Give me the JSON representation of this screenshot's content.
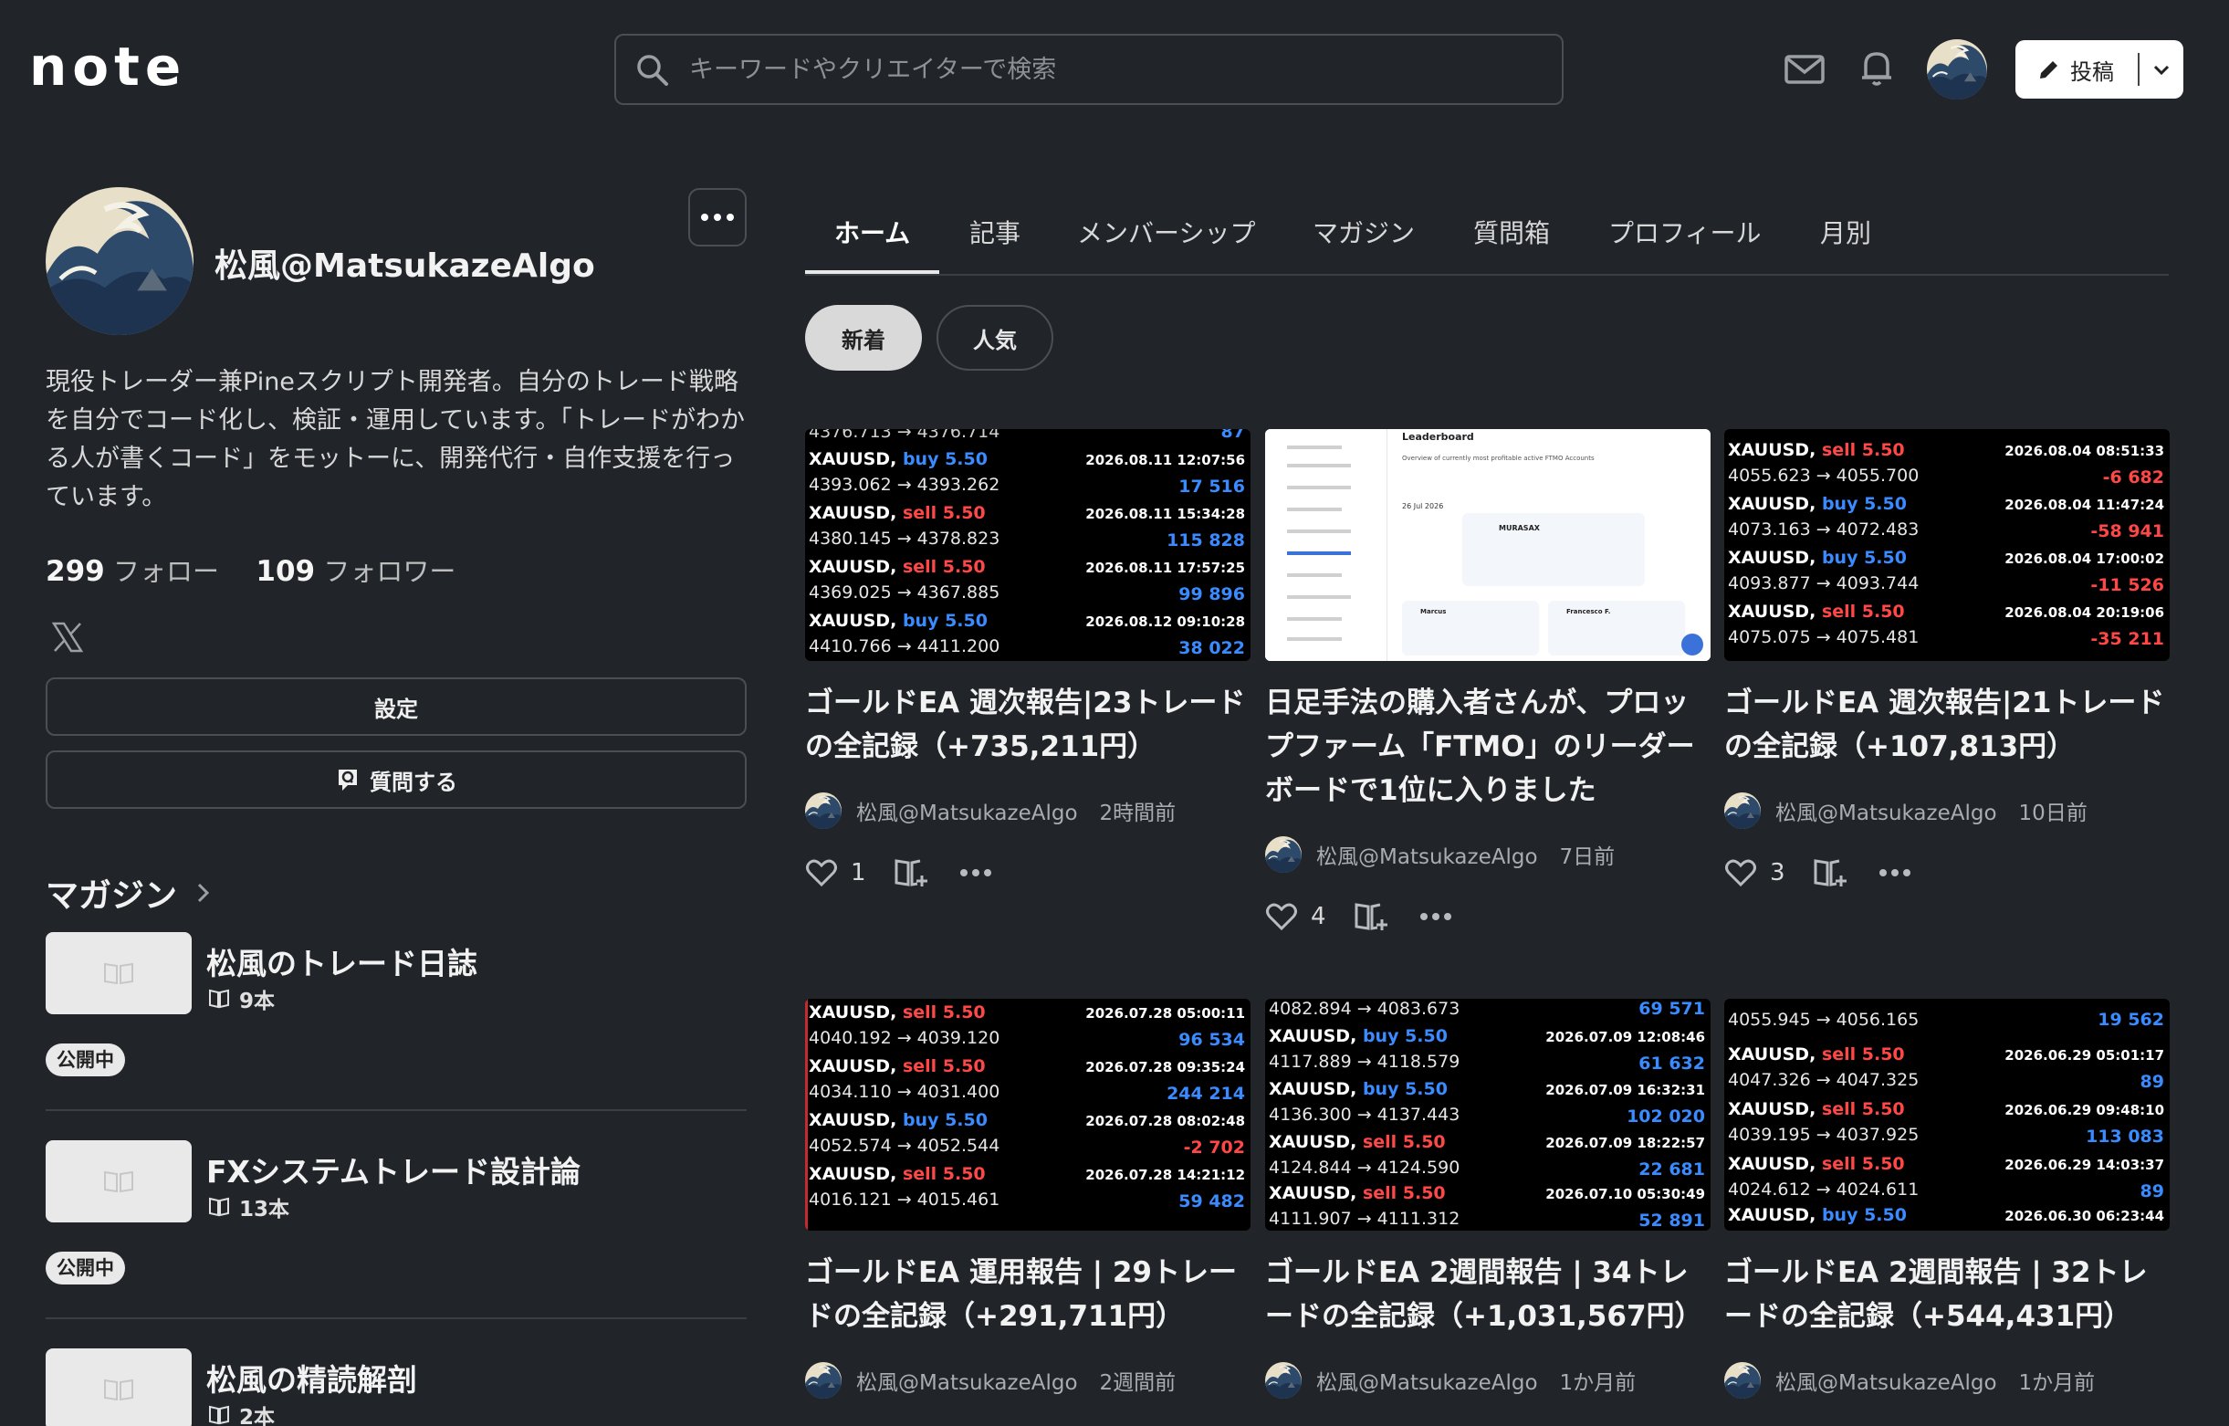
{
  "header": {
    "logo": "note",
    "search_placeholder": "キーワードやクリエイターで検索",
    "post_label": "投稿"
  },
  "profile": {
    "name": "松風@MatsukazeAlgo",
    "bio": "現役トレーダー兼Pineスクリプト開発者。自分のトレード戦略を自分でコード化し、検証・運用しています。「トレードがわかる人が書くコード」をモットーに、開発代行・自作支援を行っています。",
    "follow_count": "299",
    "follow_label": "フォロー",
    "follower_count": "109",
    "follower_label": "フォロワー",
    "settings_label": "設定",
    "ask_label": "質問する"
  },
  "magazines": {
    "heading": "マガジン",
    "items": [
      {
        "title": "松風のトレード日誌",
        "count": "9本",
        "badge": "公開中"
      },
      {
        "title": "FXシステムトレード設計論",
        "count": "13本",
        "badge": "公開中"
      },
      {
        "title": "松風の精読解剖",
        "count": "2本",
        "badge": ""
      }
    ]
  },
  "tabs": [
    "ホーム",
    "記事",
    "メンバーシップ",
    "マガジン",
    "質問箱",
    "プロフィール",
    "月別"
  ],
  "filters": {
    "new": "新着",
    "popular": "人気"
  },
  "articles": [
    {
      "title": "ゴールドEA 週次報告|23トレードの全記録（+735,211円）",
      "author": "松風@MatsukazeAlgo",
      "time": "2時間前",
      "likes": "1",
      "top_partial": "4376.713 → 4376.714",
      "top_partial_pnl": "87",
      "trades": [
        {
          "sym": "XAUUSD,",
          "side": "buy 5.50",
          "dir": "buy",
          "dt": "2026.08.11 12:07:56",
          "px": "4393.062 → 4393.262",
          "pnl": "17 516"
        },
        {
          "sym": "XAUUSD,",
          "side": "sell 5.50",
          "dir": "sell",
          "dt": "2026.08.11 15:34:28",
          "px": "4380.145 → 4378.823",
          "pnl": "115 828"
        },
        {
          "sym": "XAUUSD,",
          "side": "sell 5.50",
          "dir": "sell",
          "dt": "2026.08.11 17:57:25",
          "px": "4369.025 → 4367.885",
          "pnl": "99 896"
        },
        {
          "sym": "XAUUSD,",
          "side": "buy 5.50",
          "dir": "buy",
          "dt": "2026.08.12 09:10:28",
          "px": "4410.766 → 4411.200",
          "pnl": "38 022"
        }
      ]
    },
    {
      "title": "日足手法の購入者さんが、プロップファーム「FTMO」のリーダーボードで1位に入りました",
      "author": "松風@MatsukazeAlgo",
      "time": "7日前",
      "likes": "4",
      "leaderboard": {
        "heading": "Leaderboard",
        "sub": "Overview of currently most profitable active FTMO Accounts",
        "date": "26 Jul 2026",
        "name1": "MURASAX",
        "name2": "Marcus",
        "name3": "Francesco F."
      }
    },
    {
      "title": "ゴールドEA 週次報告|21トレードの全記録（+107,813円）",
      "author": "松風@MatsukazeAlgo",
      "time": "10日前",
      "likes": "3",
      "trades": [
        {
          "sym": "XAUUSD,",
          "side": "sell 5.50",
          "dir": "sell",
          "dt": "2026.08.04 08:51:33",
          "px": "4055.623 → 4055.700",
          "pnl": "-6 682"
        },
        {
          "sym": "XAUUSD,",
          "side": "buy 5.50",
          "dir": "buy",
          "dt": "2026.08.04 11:47:24",
          "px": "4073.163 → 4072.483",
          "pnl": "-58 941"
        },
        {
          "sym": "XAUUSD,",
          "side": "buy 5.50",
          "dir": "buy",
          "dt": "2026.08.04 17:00:02",
          "px": "4093.877 → 4093.744",
          "pnl": "-11 526"
        },
        {
          "sym": "XAUUSD,",
          "side": "sell 5.50",
          "dir": "sell",
          "dt": "2026.08.04 20:19:06",
          "px": "4075.075 → 4075.481",
          "pnl": "-35 211"
        }
      ]
    },
    {
      "title": "ゴールドEA 運用報告 | 29トレードの全記録（+291,711円）",
      "author": "松風@MatsukazeAlgo",
      "time": "2週間前",
      "trades": [
        {
          "sym": "XAUUSD,",
          "side": "sell 5.50",
          "dir": "sell",
          "dt": "2026.07.28 05:00:11",
          "px": "4040.192 → 4039.120",
          "pnl": "96 534"
        },
        {
          "sym": "XAUUSD,",
          "side": "sell 5.50",
          "dir": "sell",
          "dt": "2026.07.28 09:35:24",
          "px": "4034.110 → 4031.400",
          "pnl": "244 214"
        },
        {
          "sym": "XAUUSD,",
          "side": "buy 5.50",
          "dir": "buy",
          "dt": "2026.07.28 08:02:48",
          "px": "4052.574 → 4052.544",
          "pnl": "-2 702"
        },
        {
          "sym": "XAUUSD,",
          "side": "sell 5.50",
          "dir": "sell",
          "dt": "2026.07.28 14:21:12",
          "px": "4016.121 → 4015.461",
          "pnl": "59 482"
        }
      ]
    },
    {
      "title": "ゴールドEA 2週間報告 | 34トレードの全記録（+1,031,567円）",
      "author": "松風@MatsukazeAlgo",
      "time": "1か月前",
      "top_partial": "4082.894 → 4083.673",
      "top_partial_pnl": "69 571",
      "trades": [
        {
          "sym": "XAUUSD,",
          "side": "buy 5.50",
          "dir": "buy",
          "dt": "2026.07.09 12:08:46",
          "px": "4117.889 → 4118.579",
          "pnl": "61 632"
        },
        {
          "sym": "XAUUSD,",
          "side": "buy 5.50",
          "dir": "buy",
          "dt": "2026.07.09 16:32:31",
          "px": "4136.300 → 4137.443",
          "pnl": "102 020"
        },
        {
          "sym": "XAUUSD,",
          "side": "sell 5.50",
          "dir": "sell",
          "dt": "2026.07.09 18:22:57",
          "px": "4124.844 → 4124.590",
          "pnl": "22 681"
        },
        {
          "sym": "XAUUSD,",
          "side": "sell 5.50",
          "dir": "sell",
          "dt": "2026.07.10 05:30:49",
          "px": "4111.907 → 4111.312",
          "pnl": "52 891"
        }
      ]
    },
    {
      "title": "ゴールドEA 2週間報告 | 32トレードの全記録（+544,431円）",
      "author": "松風@MatsukazeAlgo",
      "time": "1か月前",
      "top_partial": "4055.945 → 4056.165",
      "top_partial_pnl": "19 562",
      "trades": [
        {
          "sym": "XAUUSD,",
          "side": "sell 5.50",
          "dir": "sell",
          "dt": "2026.06.29 05:01:17",
          "px": "4047.326 → 4047.325",
          "pnl": "89"
        },
        {
          "sym": "XAUUSD,",
          "side": "sell 5.50",
          "dir": "sell",
          "dt": "2026.06.29 09:48:10",
          "px": "4039.195 → 4037.925",
          "pnl": "113 083"
        },
        {
          "sym": "XAUUSD,",
          "side": "sell 5.50",
          "dir": "sell",
          "dt": "2026.06.29 14:03:37",
          "px": "4024.612 → 4024.611",
          "pnl": "89"
        },
        {
          "sym": "XAUUSD,",
          "side": "buy 5.50",
          "dir": "buy",
          "dt": "2026.06.30 06:23:44",
          "px": "",
          "pnl": ""
        }
      ]
    }
  ],
  "colors": {
    "bg": "#212529",
    "buy": "#3a8bff",
    "sell": "#ff4747",
    "pill_active": "#d9d9da"
  }
}
